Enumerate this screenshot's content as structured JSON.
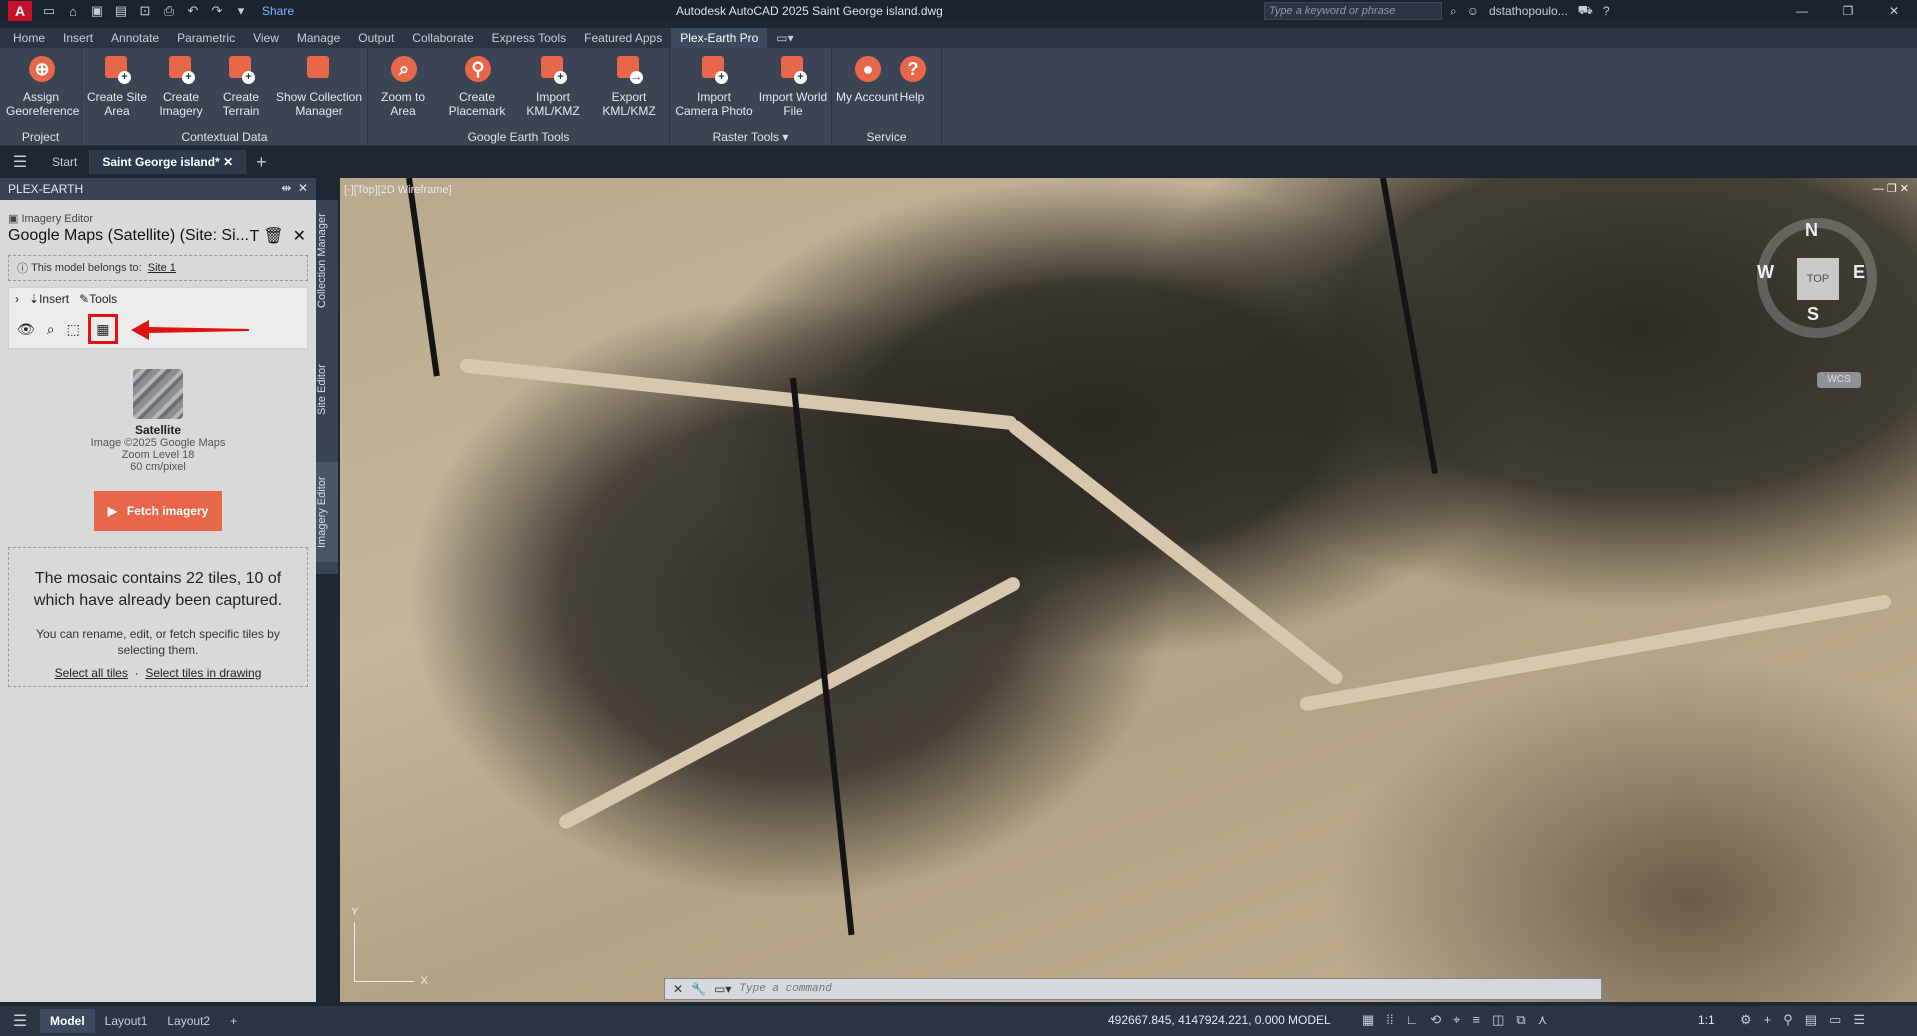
{
  "titlebar": {
    "app_letter": "A",
    "share_label": "Share",
    "title": "Autodesk AutoCAD 2025   Saint George island.dwg",
    "search_placeholder": "Type a keyword or phrase",
    "user": "dstathopoulo..."
  },
  "ribbon_tabs": [
    "Home",
    "Insert",
    "Annotate",
    "Parametric",
    "View",
    "Manage",
    "Output",
    "Collaborate",
    "Express Tools",
    "Featured Apps",
    "Plex-Earth Pro"
  ],
  "active_ribbon_tab": "Plex-Earth Pro",
  "ribbon": {
    "groups": {
      "project": "Project",
      "contextual": "Contextual Data",
      "google": "Google Earth Tools",
      "raster": "Raster Tools",
      "service": "Service"
    },
    "buttons": {
      "assign": "Assign Georeference",
      "site_area": "Create Site Area",
      "imagery": "Create Imagery",
      "terrain": "Create Terrain",
      "collection": "Show Collection Manager",
      "zoom": "Zoom to Area",
      "placemark": "Create Placemark",
      "import_kml": "Import KML/KMZ",
      "export_kml": "Export KML/KMZ",
      "camera": "Import Camera Photo",
      "world": "Import World File",
      "account": "My Account",
      "help": "Help"
    }
  },
  "doc_tabs": {
    "start": "Start",
    "active": "Saint George island*"
  },
  "palette": {
    "title": "PLEX-EARTH",
    "editor_label": "Imagery Editor",
    "editor_title": "Google Maps (Satellite) (Site: Si...",
    "belongs_text": "This model belongs to:",
    "belongs_link": "Site 1",
    "insert_label": "Insert",
    "tools_label": "Tools",
    "imagery_name": "Satellite",
    "imagery_copyright": "Image ©2025 Google Maps",
    "zoom_level": "Zoom Level 18",
    "resolution": "60 cm/pixel",
    "fetch_label": "Fetch imagery",
    "mosaic_text": "The mosaic contains 22 tiles, 10 of which have already been captured.",
    "mosaic_hint": "You can rename, edit, or fetch specific tiles by selecting them.",
    "select_all": "Select all tiles",
    "select_drawing": "Select tiles in drawing"
  },
  "side_tabs": [
    "Collection Manager",
    "Site Editor",
    "Imagery Editor"
  ],
  "viewport": {
    "label": "[-][Top][2D Wireframe]",
    "compass": {
      "n": "N",
      "s": "S",
      "e": "E",
      "w": "W",
      "top": "TOP"
    },
    "wcs": "WCS",
    "ucs_x": "X",
    "ucs_y": "Y",
    "command_placeholder": "Type a command"
  },
  "statusbar": {
    "layouts": [
      "Model",
      "Layout1",
      "Layout2"
    ],
    "coords": "492667.845, 4147924.221, 0.000",
    "model": "MODEL",
    "scale": "1:1"
  },
  "colors": {
    "accent": "#e8674a",
    "highlight": "#e01313"
  }
}
